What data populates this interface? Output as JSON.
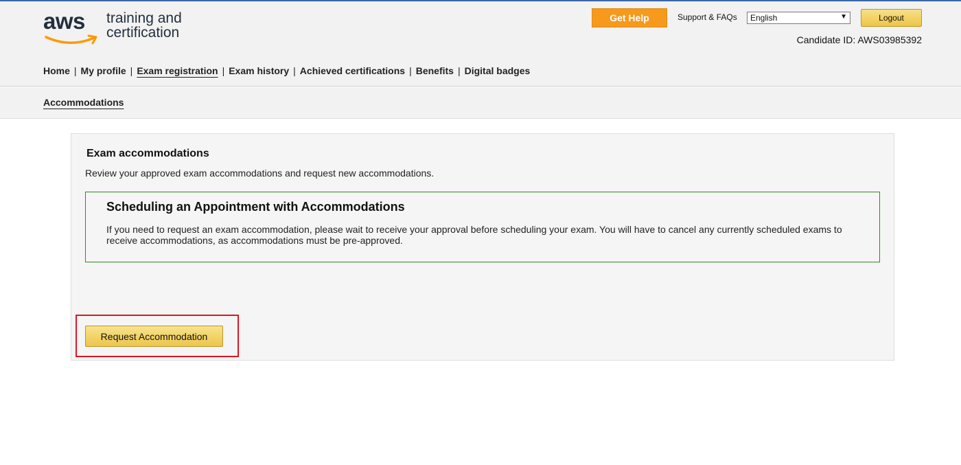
{
  "brand": {
    "logo_word": "aws",
    "tagline_line1": "training and",
    "tagline_line2": "certification",
    "colors": {
      "smile": "#ff9900",
      "text": "#232f3e",
      "accent_bar": "#3b66a8"
    }
  },
  "header": {
    "get_help_label": "Get Help",
    "support_label": "Support & FAQs",
    "language": {
      "selected": "English"
    },
    "logout_label": "Logout",
    "candidate_id": "Candidate ID: AWS03985392"
  },
  "nav": {
    "items": [
      {
        "label": "Home",
        "active": false
      },
      {
        "label": "My profile",
        "active": false
      },
      {
        "label": "Exam registration",
        "active": true
      },
      {
        "label": "Exam history",
        "active": false
      },
      {
        "label": "Achieved certifications",
        "active": false
      },
      {
        "label": "Benefits",
        "active": false
      },
      {
        "label": "Digital badges",
        "active": false
      }
    ],
    "separator": "|"
  },
  "subnav": {
    "label": "Accommodations"
  },
  "main": {
    "title": "Exam accommodations",
    "description": "Review your approved exam accommodations and request new accommodations.",
    "notice": {
      "heading": "Scheduling an Appointment with Accommodations",
      "body": "If you need to request an exam accommodation, please wait to receive your approval before scheduling your exam. You will have to cancel any currently scheduled exams to receive accommodations, as accommodations must be pre-approved.",
      "border_color": "#2e8b1f"
    },
    "request_button_label": "Request Accommodation",
    "highlight_color": "#e0141e"
  }
}
